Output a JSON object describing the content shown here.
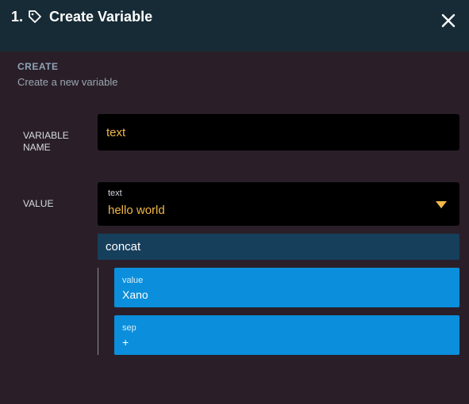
{
  "header": {
    "step": "1.",
    "title": "Create Variable",
    "tag_icon": "tag-icon",
    "close_icon": "close-icon"
  },
  "section": {
    "heading": "CREATE",
    "subtitle": "Create a new variable"
  },
  "fields": {
    "variable_name_label": "VARIABLE NAME",
    "variable_name_value": "text",
    "value_label": "VALUE",
    "value_type": "text",
    "value_value": "hello world"
  },
  "filter": {
    "name": "concat",
    "args": [
      {
        "key": "value",
        "value": "Xano"
      },
      {
        "key": "sep",
        "value": "+"
      }
    ]
  },
  "colors": {
    "header_bg": "#172b36",
    "body_bg": "#2a1f28",
    "input_bg": "#000000",
    "accent_text": "#f0b848",
    "filter_bg": "#163f5c",
    "arg_bg": "#0b8fdc"
  }
}
